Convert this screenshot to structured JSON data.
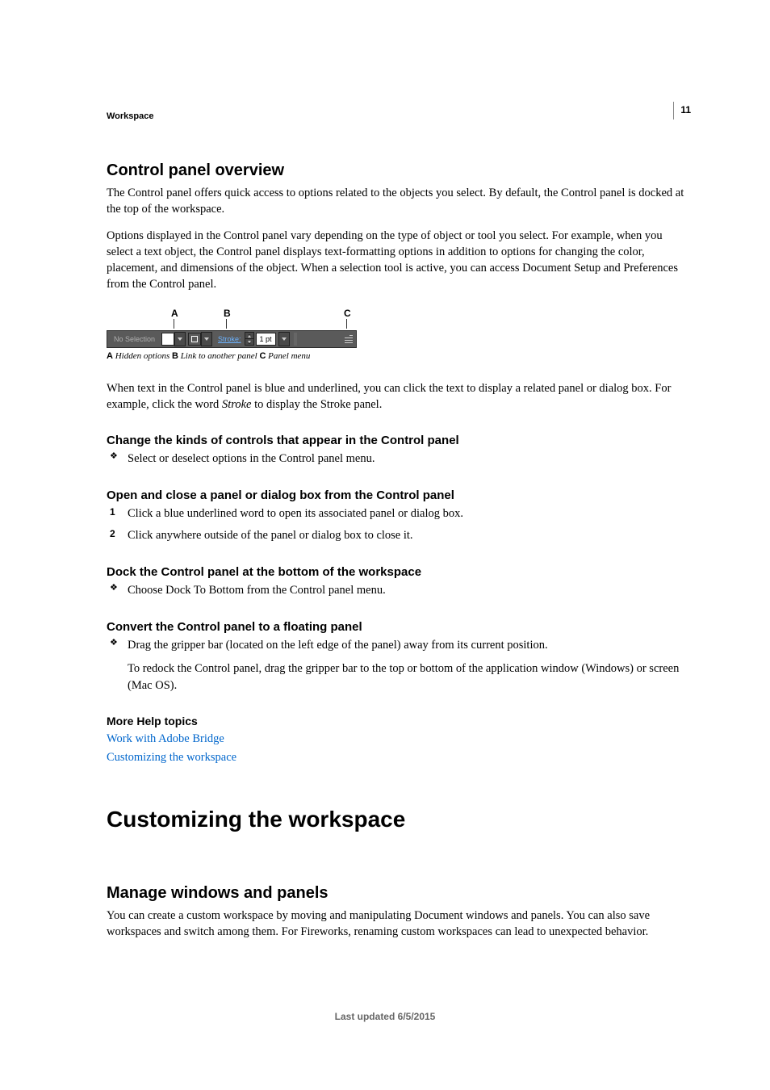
{
  "page_number": "11",
  "header": "Workspace",
  "h2_control": "Control panel overview",
  "p1": "The Control panel offers quick access to options related to the objects you select. By default, the Control panel is docked at the top of the workspace.",
  "p2": "Options displayed in the Control panel vary depending on the type of object or tool you select. For example, when you select a text object, the Control panel displays text-formatting options in addition to options for changing the color, placement, and dimensions of the object. When a selection tool is active, you can access Document Setup and Preferences from the Control panel.",
  "callout_a": "A",
  "callout_b": "B",
  "callout_c": "C",
  "fig_nosel": "No Selection",
  "fig_stroke_link": "Stroke:",
  "fig_stroke_val": "1 pt",
  "caption_a_bold": "A",
  "caption_a": " Hidden options  ",
  "caption_b_bold": "B",
  "caption_b": " Link to another panel  ",
  "caption_c_bold": "C",
  "caption_c": " Panel menu",
  "p3a": "When text in the Control panel is blue and underlined, you can click the text to display a related panel or dialog box. For example, click the word ",
  "p3_italic": "Stroke",
  "p3b": " to display the Stroke panel.",
  "sub1": "Change the kinds of controls that appear in the Control panel",
  "sub1_b1": "Select or deselect options in the Control panel menu.",
  "sub2": "Open and close a panel or dialog box from the Control panel",
  "sub2_s1": "Click a blue underlined word to open its associated panel or dialog box.",
  "sub2_s2": "Click anywhere outside of the panel or dialog box to close it.",
  "sub3": "Dock the Control panel at the bottom of the workspace",
  "sub3_b1": "Choose Dock To Bottom from the Control panel menu.",
  "sub4": "Convert the Control panel to a floating panel",
  "sub4_b1": "Drag the gripper bar (located on the left edge of the panel) away from its current position.",
  "sub4_p": "To redock the Control panel, drag the gripper bar to the top or bottom of the application window (Windows) or screen (Mac OS).",
  "help_heading": "More Help topics",
  "help_link1": "Work with Adobe Bridge",
  "help_link2": "Customizing the workspace",
  "h1_chapter": "Customizing the workspace",
  "h2_manage": "Manage windows and panels",
  "p_manage": "You can create a custom workspace by moving and manipulating Document windows and panels. You can also save workspaces and switch among them. For Fireworks, renaming custom workspaces can lead to unexpected behavior.",
  "footer": "Last updated 6/5/2015"
}
